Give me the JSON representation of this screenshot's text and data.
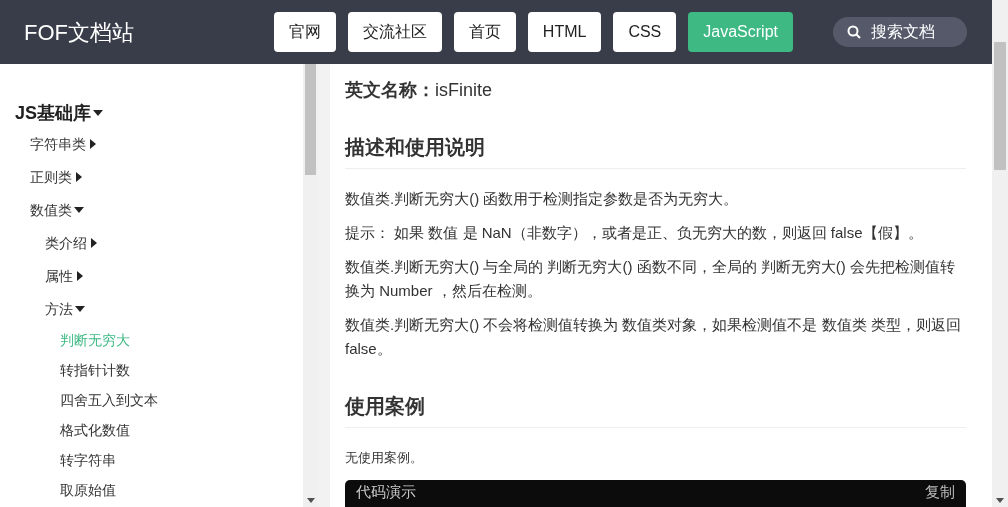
{
  "header": {
    "logo": "FOF文档站",
    "nav": [
      {
        "label": "官网",
        "selected": false
      },
      {
        "label": "交流社区",
        "selected": false
      },
      {
        "label": "首页",
        "selected": false
      },
      {
        "label": "HTML",
        "selected": false
      },
      {
        "label": "CSS",
        "selected": false
      },
      {
        "label": "JavaScript",
        "selected": true
      }
    ],
    "search": {
      "placeholder": "搜索文档"
    }
  },
  "sidebar": {
    "items": [
      {
        "label": "JS基础库",
        "expanded": true,
        "children": [
          {
            "label": "字符串类",
            "expanded": false
          },
          {
            "label": "正则类",
            "expanded": false
          },
          {
            "label": "数值类",
            "expanded": true,
            "children": [
              {
                "label": "类介绍",
                "expanded": false
              },
              {
                "label": "属性",
                "expanded": false
              },
              {
                "label": "方法",
                "expanded": true,
                "children": [
                  {
                    "label": "判断无穷大",
                    "selected": true
                  },
                  {
                    "label": "转指针计数",
                    "selected": false
                  },
                  {
                    "label": "四舍五入到文本",
                    "selected": false
                  },
                  {
                    "label": "格式化数值",
                    "selected": false
                  },
                  {
                    "label": "转字符串",
                    "selected": false
                  },
                  {
                    "label": "取原始值",
                    "selected": false
                  }
                ]
              }
            ]
          }
        ]
      }
    ]
  },
  "content": {
    "english_name": {
      "label": "英文名称：",
      "value": "isFinite"
    },
    "sections": [
      {
        "heading": "描述和使用说明",
        "paragraphs": [
          "数值类.判断无穷大() 函数用于检测指定参数是否为无穷大。",
          "提示： 如果 数值 是 NaN（非数字），或者是正、负无穷大的数，则返回 false【假】。",
          "数值类.判断无穷大() 与全局的 判断无穷大() 函数不同，全局的 判断无穷大() 会先把检测值转换为 Number ，然后在检测。",
          "数值类.判断无穷大() 不会将检测值转换为 数值类对象，如果检测值不是 数值类 类型，则返回 false。"
        ]
      },
      {
        "heading": "使用案例",
        "paragraphs": [
          "无使用案例。"
        ]
      }
    ],
    "code_block": {
      "title": "代码演示",
      "copy": "复制"
    }
  }
}
